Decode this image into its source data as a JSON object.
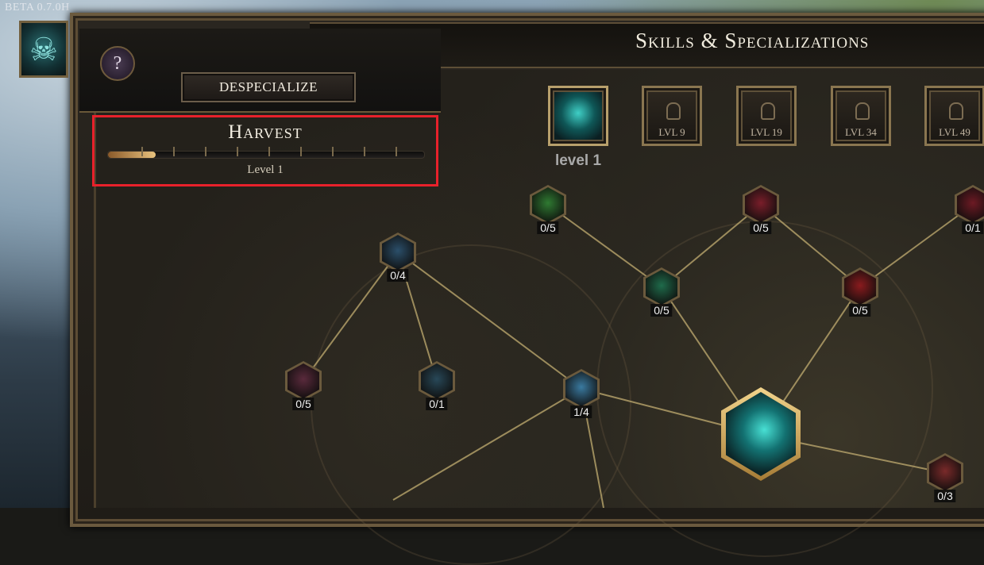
{
  "version_label": "BETA 0.7.0H",
  "header": {
    "title": "Skills & Specializations",
    "help_label": "?",
    "despecialize_label": "DESPECIALIZE"
  },
  "skill": {
    "name": "Harvest",
    "level_label": "Level 1",
    "xp_progress": 0.15
  },
  "specialization_slots": [
    {
      "label": "",
      "state": "active"
    },
    {
      "label": "LVL 9",
      "state": "locked"
    },
    {
      "label": "LVL 19",
      "state": "locked"
    },
    {
      "label": "LVL 34",
      "state": "locked"
    },
    {
      "label": "LVL 49",
      "state": "locked"
    }
  ],
  "active_slot_label": "level 1",
  "nodes": [
    {
      "count": "0/5",
      "icon": "green-claws-icon",
      "color": "#2f7a32"
    },
    {
      "count": "0/5",
      "icon": "red-slash-icon",
      "color": "#7a1e2a"
    },
    {
      "count": "0/1",
      "icon": "red-aura-icon",
      "color": "#6d1a24"
    },
    {
      "count": "0/4",
      "icon": "frost-tree-icon",
      "color": "#2b4f6a"
    },
    {
      "count": "0/5",
      "icon": "green-skull-icon",
      "color": "#1f6b4b"
    },
    {
      "count": "0/5",
      "icon": "blood-drops-icon",
      "color": "#8a1b1e"
    },
    {
      "count": "0/5",
      "icon": "crimson-fan-icon",
      "color": "#5a2a3c"
    },
    {
      "count": "0/1",
      "icon": "shadow-figures-icon",
      "color": "#284858"
    },
    {
      "count": "1/4",
      "icon": "scythe-blade-icon",
      "color": "#3a7aa0"
    },
    {
      "count": "0/3",
      "icon": "red-claw-icon",
      "color": "#7a2a2a"
    },
    {
      "count": "",
      "icon": "teal-sigil-icon",
      "color": "#1f5a5a"
    }
  ]
}
